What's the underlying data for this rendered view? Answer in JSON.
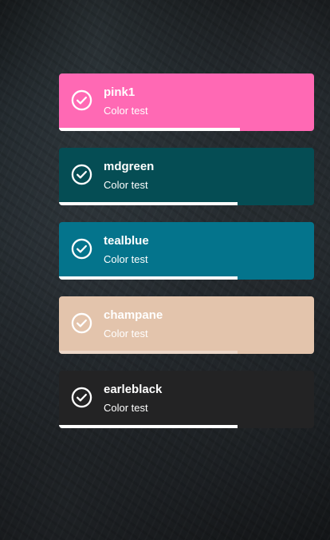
{
  "toasts": [
    {
      "title": "pink1",
      "message": "Color test",
      "color": "#ff69b4",
      "icon": "check-circle-icon",
      "progress": 0.71
    },
    {
      "title": "mdgreen",
      "message": "Color test",
      "color": "#054d54",
      "icon": "check-circle-icon",
      "progress": 0.7
    },
    {
      "title": "tealblue",
      "message": "Color test",
      "color": "#04748c",
      "icon": "check-circle-icon",
      "progress": 0.7
    },
    {
      "title": "champane",
      "message": "Color test",
      "color": "#e3c4ac",
      "icon": "check-circle-icon",
      "progress": 0.7
    },
    {
      "title": "earleblack",
      "message": "Color test",
      "color": "#232324",
      "icon": "check-circle-icon",
      "progress": 0.7
    }
  ]
}
